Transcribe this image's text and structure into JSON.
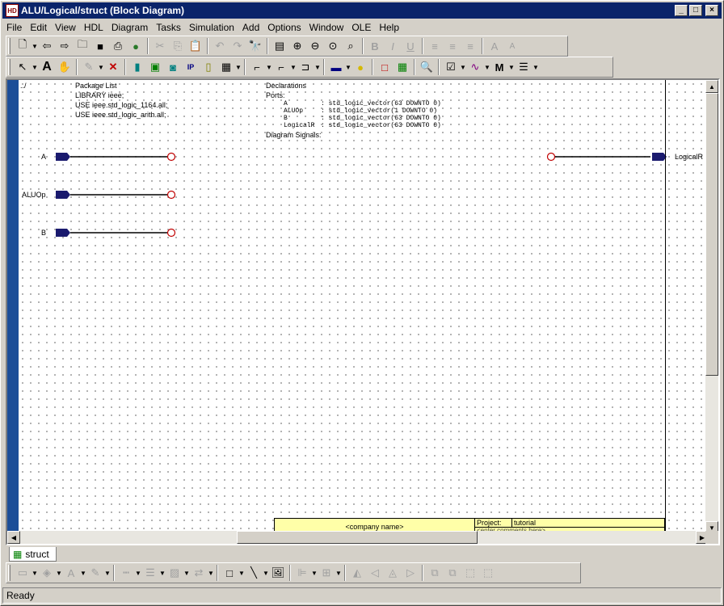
{
  "window": {
    "title": "ALU/Logical/struct (Block Diagram)",
    "app_icon": "HD"
  },
  "menu": [
    "File",
    "Edit",
    "View",
    "HDL",
    "Diagram",
    "Tasks",
    "Simulation",
    "Add",
    "Options",
    "Window",
    "OLE",
    "Help"
  ],
  "canvas": {
    "path_marker": "../",
    "package_list": {
      "heading": "Package List",
      "lines": [
        "LIBRARY ieee;",
        "USE ieee.std_logic_1164.all;",
        "USE ieee.std_logic_arith.all;"
      ]
    },
    "declarations": {
      "heading": "Declarations",
      "ports_label": "Ports:",
      "ports": [
        {
          "name": "A",
          "type": ": std_logic_vector(63 DOWNTO 0)"
        },
        {
          "name": "ALUOp",
          "type": ": std_logic_vector(1 DOWNTO 0)"
        },
        {
          "name": "B",
          "type": ": std_logic_vector(63 DOWNTO 0)"
        },
        {
          "name": "LogicalR",
          "type": ": std_logic_vector(63 DOWNTO 0)"
        }
      ],
      "signals_label": "Diagram Signals:"
    },
    "in_ports": [
      "A",
      "ALUOp",
      "B"
    ],
    "out_port": "LogicalR",
    "title_block": {
      "company": "<company name>",
      "project_label": "Project:",
      "project_value": "tutorial",
      "next_row": "<enter comments here>"
    }
  },
  "tab": {
    "label": "struct"
  },
  "status": {
    "text": "Ready"
  },
  "colors": {
    "title_bar": "#0a246a",
    "canvas_left_bar": "#1c4e98",
    "port_fill": "#1a1a6e",
    "title_block_bg": "#ffffa8",
    "connector_ring": "#c00000"
  }
}
